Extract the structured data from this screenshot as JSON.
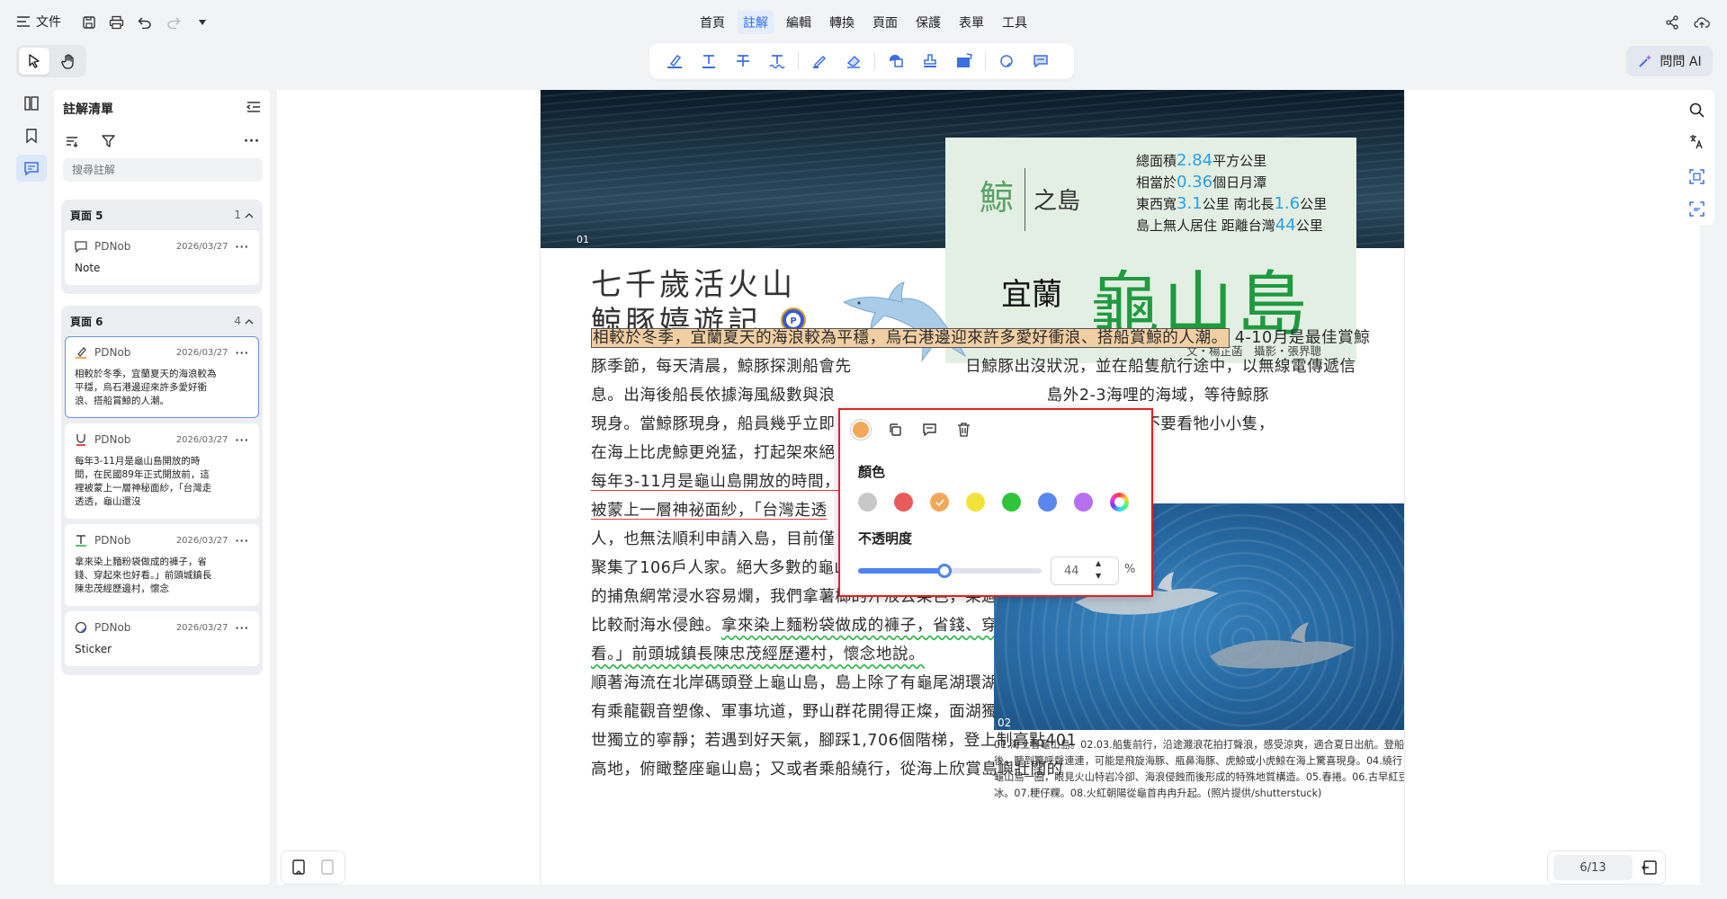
{
  "topbar": {
    "file_label": "文件",
    "menu": [
      "首頁",
      "註解",
      "編輯",
      "轉換",
      "頁面",
      "保護",
      "表單",
      "工具"
    ],
    "active_menu": "註解",
    "ask_ai": "問問 AI"
  },
  "panel": {
    "title": "註解清單",
    "search_placeholder": "搜尋註解",
    "groups": [
      {
        "title": "頁面 5",
        "count": "1",
        "items": [
          {
            "icon": "note-icon",
            "author": "PDNob",
            "date": "2026/03/27",
            "text": "Note"
          }
        ]
      },
      {
        "title": "頁面 6",
        "count": "4",
        "items": [
          {
            "icon": "highlight-icon",
            "author": "PDNob",
            "date": "2026/03/27",
            "text": "相較於冬季，宜蘭夏天的海浪較為平穩，烏石港邊迎來許多愛好衝浪、搭船賞鯨的人潮。"
          },
          {
            "icon": "underline-icon",
            "author": "PDNob",
            "date": "2026/03/27",
            "text": "每年3-11月是龜山島開放的時間，在民國89年正式開放前，這裡被蒙上一層神秘面紗，「台灣走透透，龜山還沒"
          },
          {
            "icon": "textbox-icon",
            "author": "PDNob",
            "date": "2026/03/27",
            "text": "拿來染上麵粉袋做成的褲子，省錢、穿起來也好看。」前頭城鎮長陳忠茂經歷邊村，懷念"
          },
          {
            "icon": "sticker-icon",
            "author": "PDNob",
            "date": "2026/03/27",
            "text": "Sticker"
          }
        ]
      }
    ]
  },
  "pdf": {
    "img1_no": "01",
    "img2_no": "02",
    "whale_char": "鯨",
    "isle_text": "之島",
    "stats": [
      [
        "總面積",
        "2.84",
        "平方公里"
      ],
      [
        "相當於",
        "0.36",
        "個日月潭"
      ],
      [
        "東西寬",
        "3.1",
        "公里 南北長",
        "1.6",
        "公里"
      ],
      [
        "島上無人居住 距離台灣",
        "44",
        "公里"
      ]
    ],
    "yilan": "宜蘭",
    "guishan": "龜山島",
    "credits": "文・楊芷菡　攝影・張界聰",
    "heading_line1": "七千歲活火山",
    "heading_line2": "鯨豚嬉遊記",
    "lines": [
      {
        "parts": [
          {
            "t": "相較於冬季，宜蘭夏天的海浪較為平穩，烏石港邊迎來許多愛好衝浪、搭船賞鯨的人潮。",
            "s": "hl"
          },
          {
            "t": " 4-10月是最佳賞鯨"
          }
        ]
      },
      {
        "parts": [
          {
            "t": "豚季節，每天清晨，鯨豚探測船會先　　　　　　　日鯨豚出沒狀況，並在船隻航行途中，以無線電傳遞信"
          }
        ]
      },
      {
        "parts": [
          {
            "t": "息。出海後船長依據海風級數與浪　　　　　　　　　　　　　島外2-3海哩的海域，等待鯨豚"
          }
        ]
      },
      {
        "parts": [
          {
            "t": "現身。當鯨豚現身，船員幾乎立即　　　　　　　　　　　　　　鯨的斑塊。不要看牠小小隻，"
          }
        ]
      },
      {
        "parts": [
          {
            "t": "在海上比虎鯨更兇猛，打起架來絕"
          }
        ]
      },
      {
        "parts": [
          {
            "t": "每年3-11月是龜山島開放的時間，",
            "s": "ul"
          }
        ]
      },
      {
        "parts": [
          {
            "t": "被蒙上一層神祕面紗，「台灣走透",
            "s": "ul"
          }
        ]
      },
      {
        "parts": [
          {
            "t": "人，也無法順利申請入島，目前僅　　　　　　　　　　"
          }
        ]
      },
      {
        "parts": [
          {
            "t": "聚集了106戶人家。絕大多數的龜山島人以捕魚維生，「用苧麻做"
          }
        ]
      },
      {
        "parts": [
          {
            "t": "的捕魚網常浸水容易爛，我們拿薯榔的汁液去染色，染過的繩網會"
          }
        ]
      },
      {
        "parts": [
          {
            "t": "比較耐海水侵蝕。"
          },
          {
            "t": "拿來染上麵粉袋做成的褲子，省錢、穿起來也好",
            "s": "sq"
          }
        ]
      },
      {
        "parts": [
          {
            "t": "看。」前頭城鎮長陳忠茂經歷遷村，懷念地說。",
            "s": "sq"
          }
        ]
      },
      {
        "parts": [
          {
            "t": "順著海流在北岸碼頭登上龜山島，島上除了有龜尾湖環湖步道，還"
          }
        ]
      },
      {
        "parts": [
          {
            "t": "有乘龍觀音塑像、軍事坑道，野山群花開得正燦，面湖獨坐頗有遺"
          }
        ]
      },
      {
        "parts": [
          {
            "t": "世獨立的寧靜；若遇到好天氣，腳踩1,706個階梯，登上制高點401"
          }
        ]
      },
      {
        "parts": [
          {
            "t": "高地，俯瞰整座龜山島；又或者乘船繞行，從海上欣賞島嶼壯闊的"
          }
        ]
      }
    ],
    "caption": "01.海上看龜山島。02.03.船隻前行，沿途濺浪花拍打聲浪，感受涼爽，適合夏日出航。登船後，聽到驚呼聲連連，可能是飛旋海豚、瓶鼻海豚、虎鯨或小虎鯨在海上驚喜現身。04.繞行龜山島一圈，眼見火山特岩冷卻、海浪侵蝕而後形成的特殊地質構造。05.春捲。06.古早紅豆冰。07.粳仔粿。08.火紅朝陽從龜首冉冉升起。(照片提供/shutterstuck)"
  },
  "popup": {
    "color_label": "顏色",
    "opacity_label": "不透明度",
    "opacity_value": "44",
    "opacity_unit": "%",
    "opacity_fraction": 0.44,
    "colors": [
      "#c8c8c8",
      "#e95b5b",
      "#f1a959",
      "#f2e33a",
      "#2fc43a",
      "#5a86ef",
      "#b56ff0",
      "rainbow"
    ],
    "selected_color": "#f1a959"
  },
  "footer": {
    "page_indicator": "6/13"
  }
}
